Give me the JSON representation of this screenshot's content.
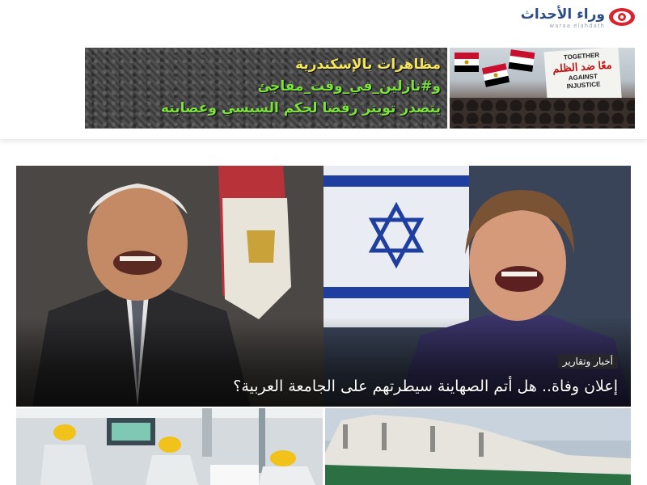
{
  "site": {
    "logo_text": "وراء الأحداث",
    "logo_subtitle": "waraa elahdath",
    "logo_icon": "eye-icon",
    "brand_color": "#d9242e",
    "logo_text_color": "#2a4c86"
  },
  "banner": {
    "lines": [
      "مظاهرات بالإسكندرية",
      "و#نازلين_في_وقت_مفاجئ",
      "يتصدر تويتر رفضا لحكم السيسي وعصابته"
    ],
    "sign_text_en": [
      "TOGETHER",
      "AGAINST",
      "INJUSTICE"
    ],
    "sign_text_ar": "معًا ضد الظلم"
  },
  "featured": {
    "category": "أخبار وتقارير",
    "headline": "إعلان وفاة.. هل أتم الصهاينة سيطرتهم على الجامعة العربية؟"
  },
  "cards": [
    {
      "image": "hospital-icu-photo"
    },
    {
      "image": "building-facade-photo"
    }
  ]
}
